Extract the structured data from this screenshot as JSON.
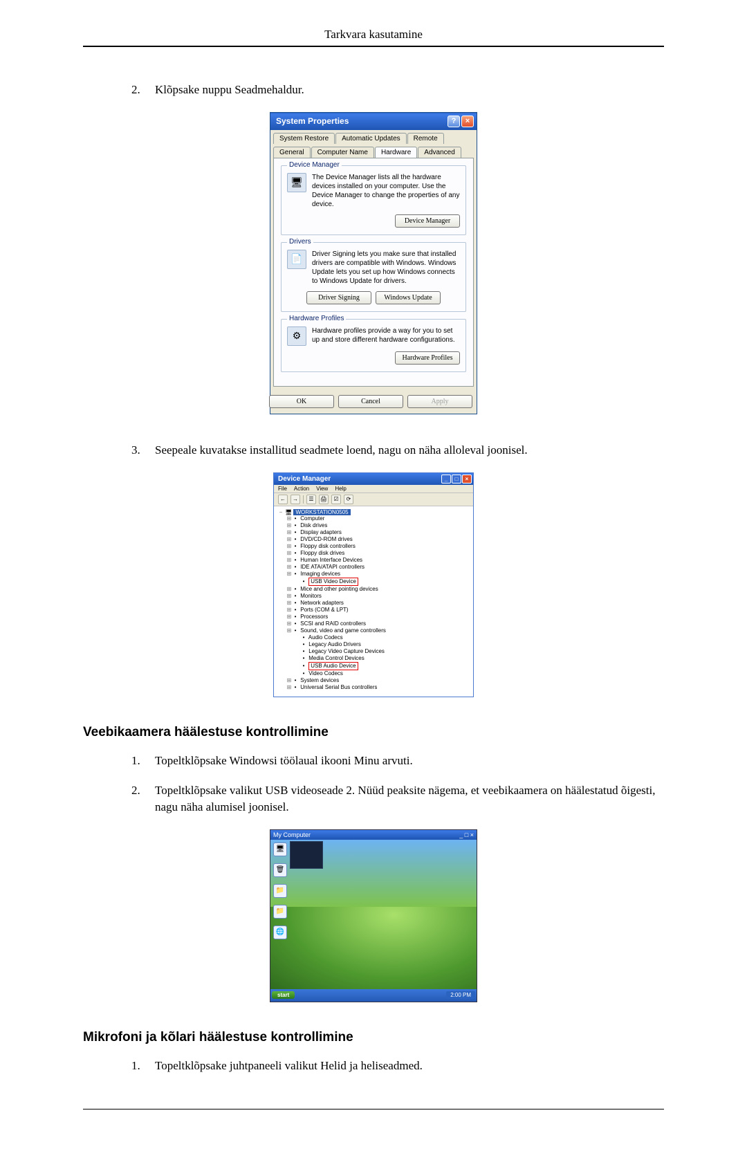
{
  "header": {
    "title": "Tarkvara kasutamine"
  },
  "steps_a": [
    {
      "num": "2.",
      "text": "Klõpsake nuppu Seadmehaldur."
    }
  ],
  "sysprops": {
    "title": "System Properties",
    "tabs_row1": [
      "System Restore",
      "Automatic Updates",
      "Remote"
    ],
    "tabs_row2": [
      "General",
      "Computer Name",
      "Hardware",
      "Advanced"
    ],
    "active_tab": "Hardware",
    "group_devmgr": {
      "label": "Device Manager",
      "desc": "The Device Manager lists all the hardware devices installed on your computer. Use the Device Manager to change the properties of any device.",
      "btn": "Device Manager"
    },
    "group_drivers": {
      "label": "Drivers",
      "desc": "Driver Signing lets you make sure that installed drivers are compatible with Windows. Windows Update lets you set up how Windows connects to Windows Update for drivers.",
      "btn1": "Driver Signing",
      "btn2": "Windows Update"
    },
    "group_profiles": {
      "label": "Hardware Profiles",
      "desc": "Hardware profiles provide a way for you to set up and store different hardware configurations.",
      "btn": "Hardware Profiles"
    },
    "footer": {
      "ok": "OK",
      "cancel": "Cancel",
      "apply": "Apply"
    }
  },
  "steps_b": [
    {
      "num": "3.",
      "text": "Seepeale kuvatakse installitud seadmete loend, nagu on näha alloleval joonisel."
    }
  ],
  "devmgr": {
    "title": "Device Manager",
    "menu": [
      "File",
      "Action",
      "View",
      "Help"
    ],
    "tree": {
      "root": "WORKSTATION0505",
      "items": [
        {
          "l": 1,
          "t": "Computer"
        },
        {
          "l": 1,
          "t": "Disk drives"
        },
        {
          "l": 1,
          "t": "Display adapters"
        },
        {
          "l": 1,
          "t": "DVD/CD-ROM drives"
        },
        {
          "l": 1,
          "t": "Floppy disk controllers"
        },
        {
          "l": 1,
          "t": "Floppy disk drives"
        },
        {
          "l": 1,
          "t": "Human Interface Devices"
        },
        {
          "l": 1,
          "t": "IDE ATA/ATAPI controllers"
        },
        {
          "l": 1,
          "t": "Imaging devices"
        },
        {
          "l": 2,
          "t": "USB Video Device",
          "box": true
        },
        {
          "l": 1,
          "t": "Mice and other pointing devices"
        },
        {
          "l": 1,
          "t": "Monitors"
        },
        {
          "l": 1,
          "t": "Network adapters"
        },
        {
          "l": 1,
          "t": "Ports (COM & LPT)"
        },
        {
          "l": 1,
          "t": "Processors"
        },
        {
          "l": 1,
          "t": "SCSI and RAID controllers"
        },
        {
          "l": 1,
          "t": "Sound, video and game controllers"
        },
        {
          "l": 2,
          "t": "Audio Codecs"
        },
        {
          "l": 2,
          "t": "Legacy Audio Drivers"
        },
        {
          "l": 2,
          "t": "Legacy Video Capture Devices"
        },
        {
          "l": 2,
          "t": "Media Control Devices"
        },
        {
          "l": 2,
          "t": "USB Audio Device",
          "box": true
        },
        {
          "l": 2,
          "t": "Video Codecs"
        },
        {
          "l": 1,
          "t": "System devices"
        },
        {
          "l": 1,
          "t": "Universal Serial Bus controllers"
        }
      ]
    }
  },
  "section_webcam": {
    "heading": "Veebikaamera häälestuse kontrollimine"
  },
  "steps_c": [
    {
      "num": "1.",
      "text": "Topeltklõpsake Windowsi töölaual ikooni Minu arvuti."
    },
    {
      "num": "2.",
      "text": "Topeltklõpsake valikut USB videoseade 2. Nüüd peaksite nägema, et veebikaamera on häälestatud õigesti, nagu näha alumisel joonisel."
    }
  ],
  "xpshot": {
    "title": "My Computer",
    "start": "start",
    "clock": "2:00 PM"
  },
  "section_mic": {
    "heading": "Mikrofoni ja kõlari häälestuse kontrollimine"
  },
  "steps_d": [
    {
      "num": "1.",
      "text": "Topeltklõpsake juhtpaneeli valikut Helid ja heliseadmed."
    }
  ]
}
